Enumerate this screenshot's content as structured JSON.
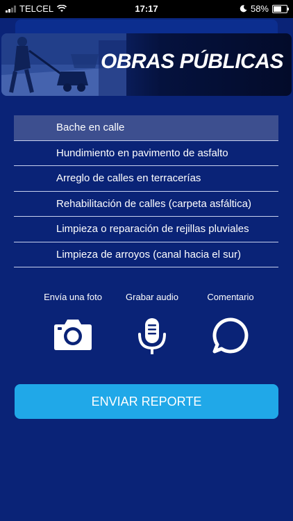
{
  "status_bar": {
    "carrier": "TELCEL",
    "time": "17:17",
    "battery": "58%"
  },
  "banner": {
    "title": "OBRAS PÚBLICAS"
  },
  "menu": {
    "items": [
      {
        "label": "Bache en calle",
        "selected": true
      },
      {
        "label": "Hundimiento en pavimento de asfalto"
      },
      {
        "label": "Arreglo de calles en terracerías"
      },
      {
        "label": "Rehabilitación de calles (carpeta asfáltica)"
      },
      {
        "label": "Limpieza o reparación de rejillas pluviales"
      },
      {
        "label": "Limpieza de arroyos (canal hacia el sur)"
      }
    ]
  },
  "actions": {
    "photo": {
      "label": "Envía una foto",
      "icon": "camera-icon"
    },
    "audio": {
      "label": "Grabar audio",
      "icon": "microphone-icon"
    },
    "comment": {
      "label": "Comentario",
      "icon": "chat-bubble-icon"
    }
  },
  "submit": {
    "label": "ENVIAR REPORTE"
  },
  "colors": {
    "background": "#0a2377",
    "selected_item": "#3d4f8f",
    "button": "#20a8e8"
  }
}
